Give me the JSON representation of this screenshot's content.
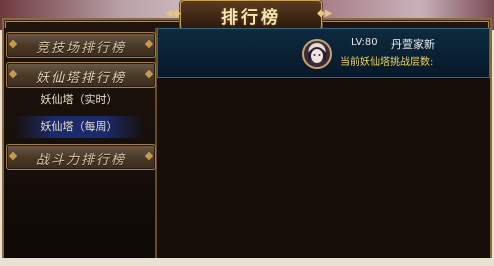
{
  "title": "排行榜",
  "sidebar": {
    "tabs": [
      {
        "label": "竞技场排行榜"
      },
      {
        "label": "妖仙塔排行榜"
      },
      {
        "label": "战斗力排行榜"
      }
    ],
    "subitems": [
      {
        "label": "妖仙塔（实时）"
      },
      {
        "label": "妖仙塔（每周）"
      }
    ]
  },
  "player": {
    "level_label": "LV:80",
    "name": "丹萱家新",
    "challenge_label": "当前妖仙塔挑战层数:"
  },
  "colors": {
    "frame_gold": "#b58a4a",
    "header_blue": "#0e2a3e",
    "selected_blue": "#1b2a6a",
    "highlight_yellow": "#f2d35c"
  },
  "icons": [
    "player-avatar-icon",
    "diamond-ornament-icon"
  ]
}
